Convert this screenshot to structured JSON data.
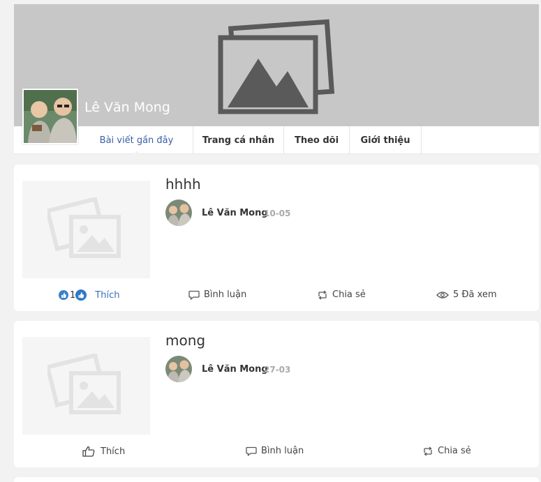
{
  "profile": {
    "name": "Lê Văn Mong"
  },
  "tabs": [
    {
      "label": "Bài viết gần đây",
      "active": true
    },
    {
      "label": "Trang cá nhân",
      "active": false
    },
    {
      "label": "Theo dõi",
      "active": false
    },
    {
      "label": "Giới thiệu",
      "active": false
    }
  ],
  "posts": [
    {
      "title": "hhhh",
      "author": "Lê Văn Mong",
      "date": "10-05",
      "like_count": "1",
      "like_label": "Thích",
      "comment_label": "Bình luận",
      "share_label": "Chia sẻ",
      "views_label": "5 Đã xem"
    },
    {
      "title": "mong",
      "author": "Lê Văn Mong",
      "date": "27-03",
      "like_label": "Thích",
      "comment_label": "Bình luận",
      "share_label": "Chia sẻ"
    }
  ],
  "colors": {
    "accent": "#3b5ea8",
    "like_blue": "#3b6fb6",
    "cover_gray": "#c7c7c7",
    "page_bg": "#f2f2f2"
  }
}
